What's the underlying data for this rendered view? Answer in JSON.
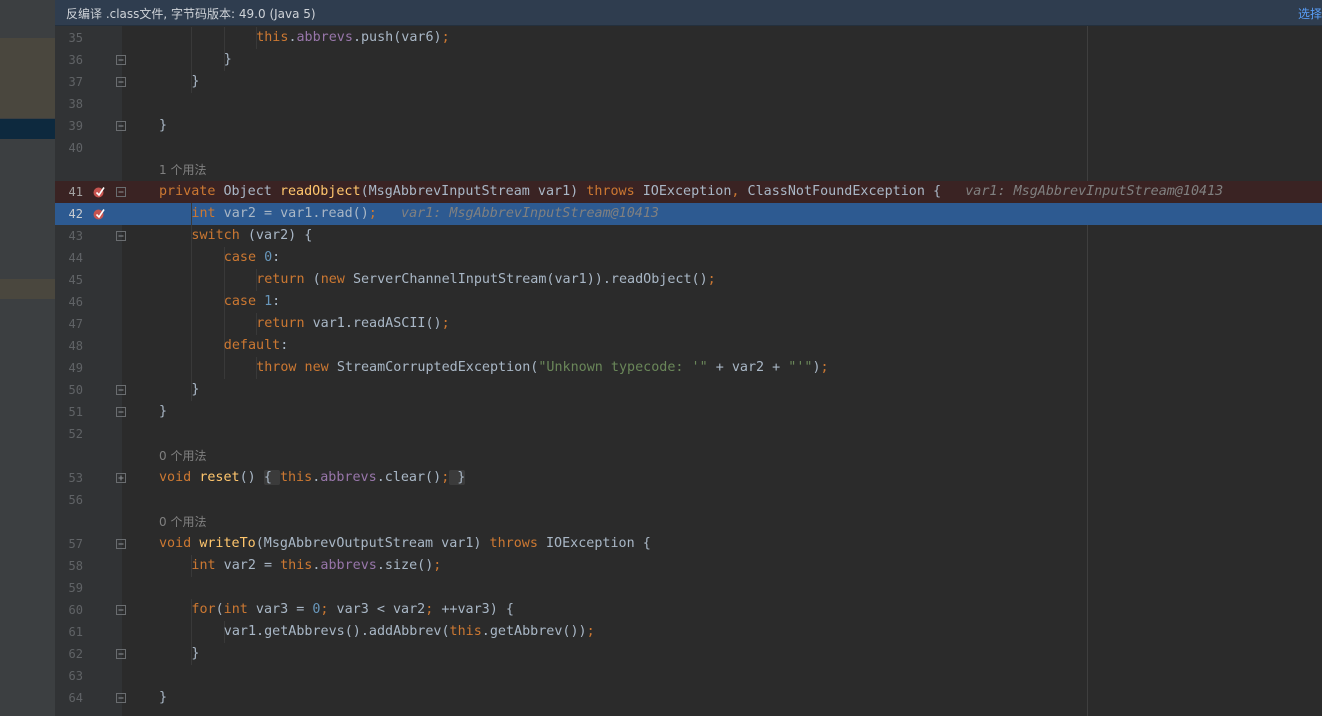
{
  "banner": {
    "text": "反编译 .class文件, 字节码版本: 49.0 (Java 5)",
    "action": "选择"
  },
  "colors": {
    "keyword": "#cc7832",
    "function": "#ffc66d",
    "field": "#9876aa",
    "number": "#6897bb",
    "string": "#6a8759",
    "current_line_bg": "#2d5a91",
    "breakpoint_line_bg": "#3a2323"
  },
  "icons": {
    "breakpoint": "verified-breakpoint-icon",
    "fold": "fold-marker-icon"
  },
  "editor": {
    "lines": [
      {
        "type": "code",
        "num": "35",
        "indent": 4,
        "fold": false,
        "tokens": [
          {
            "t": "this",
            "c": "kw"
          },
          {
            "t": ".",
            "c": ""
          },
          {
            "t": "abbrevs",
            "c": "fld"
          },
          {
            "t": ".push(var6)",
            "c": ""
          },
          {
            "t": ";",
            "c": "kw"
          }
        ]
      },
      {
        "type": "code",
        "num": "36",
        "indent": 3,
        "fold": true,
        "tokens": [
          {
            "t": "}",
            "c": ""
          }
        ]
      },
      {
        "type": "code",
        "num": "37",
        "indent": 2,
        "fold": true,
        "tokens": [
          {
            "t": "}",
            "c": ""
          }
        ]
      },
      {
        "type": "code",
        "num": "38",
        "indent": 0,
        "fold": false,
        "tokens": []
      },
      {
        "type": "code",
        "num": "39",
        "indent": 1,
        "fold": true,
        "tokens": [
          {
            "t": "}",
            "c": ""
          }
        ]
      },
      {
        "type": "code",
        "num": "40",
        "indent": 0,
        "fold": false,
        "tokens": []
      },
      {
        "type": "hint",
        "text": "1 个用法"
      },
      {
        "type": "code",
        "num": "41",
        "indent": 1,
        "fold": true,
        "bp": true,
        "bpline": true,
        "tokens": [
          {
            "t": "private ",
            "c": "kw"
          },
          {
            "t": "Object ",
            "c": ""
          },
          {
            "t": "readObject",
            "c": "fn"
          },
          {
            "t": "(MsgAbbrevInputStream var1) ",
            "c": ""
          },
          {
            "t": "throws ",
            "c": "kw"
          },
          {
            "t": "IOException",
            "c": ""
          },
          {
            "t": ", ",
            "c": "kw"
          },
          {
            "t": "ClassNotFoundException {   ",
            "c": ""
          },
          {
            "t": "var1: MsgAbbrevInputStream@10413",
            "c": "inl"
          }
        ]
      },
      {
        "type": "code",
        "num": "42",
        "indent": 2,
        "fold": false,
        "bp": true,
        "current": true,
        "tokens": [
          {
            "t": "int ",
            "c": "kw"
          },
          {
            "t": "var2 = var1.read()",
            "c": ""
          },
          {
            "t": ";",
            "c": "kw"
          },
          {
            "t": "   ",
            "c": ""
          },
          {
            "t": "var1: MsgAbbrevInputStream@10413",
            "c": "inl"
          }
        ]
      },
      {
        "type": "code",
        "num": "43",
        "indent": 2,
        "fold": true,
        "tokens": [
          {
            "t": "switch ",
            "c": "kw"
          },
          {
            "t": "(var2) {",
            "c": ""
          }
        ]
      },
      {
        "type": "code",
        "num": "44",
        "indent": 3,
        "fold": false,
        "tokens": [
          {
            "t": "case ",
            "c": "kw"
          },
          {
            "t": "0",
            "c": "num"
          },
          {
            "t": ":",
            "c": ""
          }
        ]
      },
      {
        "type": "code",
        "num": "45",
        "indent": 4,
        "fold": false,
        "tokens": [
          {
            "t": "return ",
            "c": "kw"
          },
          {
            "t": "(",
            "c": ""
          },
          {
            "t": "new ",
            "c": "kw"
          },
          {
            "t": "ServerChannelInputStream(var1)).readObject()",
            "c": ""
          },
          {
            "t": ";",
            "c": "kw"
          }
        ]
      },
      {
        "type": "code",
        "num": "46",
        "indent": 3,
        "fold": false,
        "tokens": [
          {
            "t": "case ",
            "c": "kw"
          },
          {
            "t": "1",
            "c": "num"
          },
          {
            "t": ":",
            "c": ""
          }
        ]
      },
      {
        "type": "code",
        "num": "47",
        "indent": 4,
        "fold": false,
        "tokens": [
          {
            "t": "return ",
            "c": "kw"
          },
          {
            "t": "var1.readASCII()",
            "c": ""
          },
          {
            "t": ";",
            "c": "kw"
          }
        ]
      },
      {
        "type": "code",
        "num": "48",
        "indent": 3,
        "fold": false,
        "tokens": [
          {
            "t": "default",
            "c": "kw"
          },
          {
            "t": ":",
            "c": ""
          }
        ]
      },
      {
        "type": "code",
        "num": "49",
        "indent": 4,
        "fold": false,
        "tokens": [
          {
            "t": "throw new ",
            "c": "kw"
          },
          {
            "t": "StreamCorruptedException(",
            "c": ""
          },
          {
            "t": "\"Unknown typecode: '\"",
            "c": "str"
          },
          {
            "t": " + var2 + ",
            "c": ""
          },
          {
            "t": "\"'\"",
            "c": "str"
          },
          {
            "t": ")",
            "c": ""
          },
          {
            "t": ";",
            "c": "kw"
          }
        ]
      },
      {
        "type": "code",
        "num": "50",
        "indent": 2,
        "fold": true,
        "tokens": [
          {
            "t": "}",
            "c": ""
          }
        ]
      },
      {
        "type": "code",
        "num": "51",
        "indent": 1,
        "fold": true,
        "tokens": [
          {
            "t": "}",
            "c": ""
          }
        ]
      },
      {
        "type": "code",
        "num": "52",
        "indent": 0,
        "fold": false,
        "tokens": []
      },
      {
        "type": "hint",
        "text": "0 个用法"
      },
      {
        "type": "code",
        "num": "53",
        "indent": 1,
        "fold": true,
        "foldType": "plus",
        "tokens": [
          {
            "t": "void ",
            "c": "kw"
          },
          {
            "t": "reset",
            "c": "fn"
          },
          {
            "t": "() ",
            "c": ""
          },
          {
            "t": "{ ",
            "c": "brace"
          },
          {
            "t": "this",
            "c": "kw"
          },
          {
            "t": ".",
            "c": ""
          },
          {
            "t": "abbrevs",
            "c": "fld"
          },
          {
            "t": ".clear()",
            "c": ""
          },
          {
            "t": ";",
            "c": "kw"
          },
          {
            "t": " }",
            "c": "brace"
          }
        ]
      },
      {
        "type": "code",
        "num": "56",
        "indent": 0,
        "fold": false,
        "tokens": []
      },
      {
        "type": "hint",
        "text": "0 个用法"
      },
      {
        "type": "code",
        "num": "57",
        "indent": 1,
        "fold": true,
        "tokens": [
          {
            "t": "void ",
            "c": "kw"
          },
          {
            "t": "writeTo",
            "c": "fn"
          },
          {
            "t": "(MsgAbbrevOutputStream var1) ",
            "c": ""
          },
          {
            "t": "throws ",
            "c": "kw"
          },
          {
            "t": "IOException {",
            "c": ""
          }
        ]
      },
      {
        "type": "code",
        "num": "58",
        "indent": 2,
        "fold": false,
        "tokens": [
          {
            "t": "int ",
            "c": "kw"
          },
          {
            "t": "var2 = ",
            "c": ""
          },
          {
            "t": "this",
            "c": "kw"
          },
          {
            "t": ".",
            "c": ""
          },
          {
            "t": "abbrevs",
            "c": "fld"
          },
          {
            "t": ".size()",
            "c": ""
          },
          {
            "t": ";",
            "c": "kw"
          }
        ]
      },
      {
        "type": "code",
        "num": "59",
        "indent": 0,
        "fold": false,
        "tokens": []
      },
      {
        "type": "code",
        "num": "60",
        "indent": 2,
        "fold": true,
        "tokens": [
          {
            "t": "for",
            "c": "kw"
          },
          {
            "t": "(",
            "c": ""
          },
          {
            "t": "int ",
            "c": "kw"
          },
          {
            "t": "var3 = ",
            "c": ""
          },
          {
            "t": "0",
            "c": "num"
          },
          {
            "t": "; ",
            "c": "kw"
          },
          {
            "t": "var3 < var2",
            "c": ""
          },
          {
            "t": "; ",
            "c": "kw"
          },
          {
            "t": "++var3) {",
            "c": ""
          }
        ]
      },
      {
        "type": "code",
        "num": "61",
        "indent": 3,
        "fold": false,
        "tokens": [
          {
            "t": "var1.getAbbrevs().addAbbrev(",
            "c": ""
          },
          {
            "t": "this",
            "c": "kw"
          },
          {
            "t": ".getAbbrev())",
            "c": ""
          },
          {
            "t": ";",
            "c": "kw"
          }
        ]
      },
      {
        "type": "code",
        "num": "62",
        "indent": 2,
        "fold": true,
        "tokens": [
          {
            "t": "}",
            "c": ""
          }
        ]
      },
      {
        "type": "code",
        "num": "63",
        "indent": 0,
        "fold": false,
        "tokens": []
      },
      {
        "type": "code",
        "num": "64",
        "indent": 1,
        "fold": true,
        "tokens": [
          {
            "t": "}",
            "c": ""
          }
        ]
      }
    ]
  }
}
